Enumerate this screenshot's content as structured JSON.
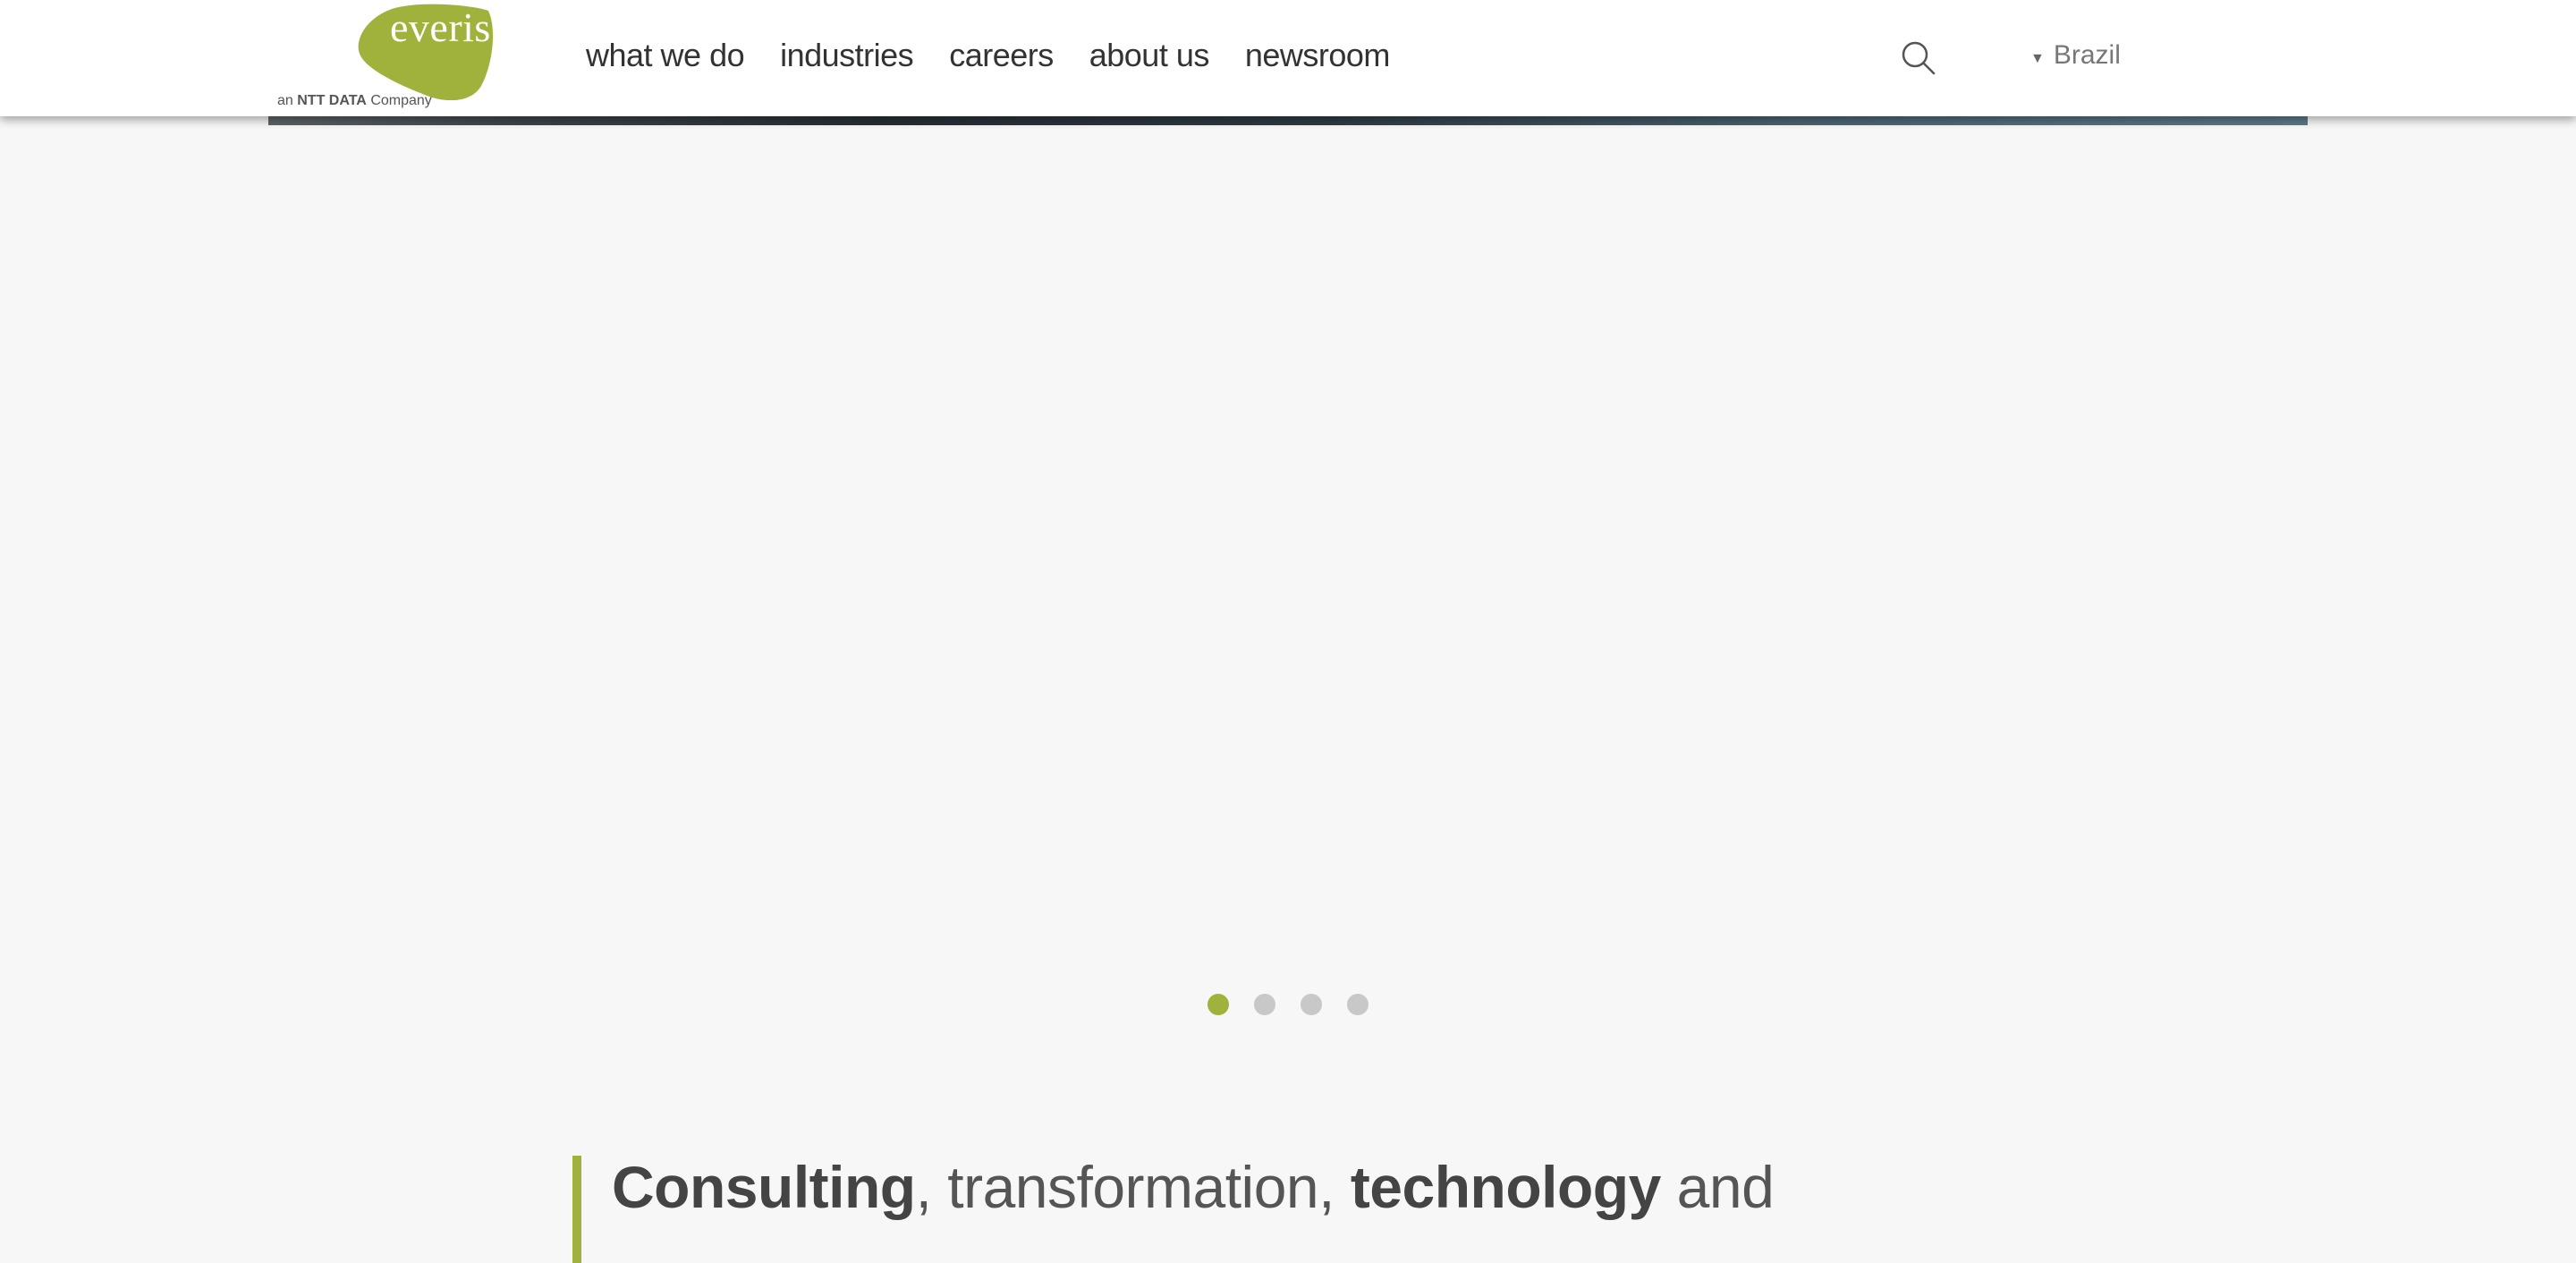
{
  "brand": {
    "logo_text": "everis",
    "tag_prefix": "an",
    "tag_strong": "NTT DATA",
    "tag_suffix": "Company",
    "logo_color": "#a0b23b"
  },
  "nav": {
    "items": [
      {
        "label": "what we do"
      },
      {
        "label": "industries"
      },
      {
        "label": "careers"
      },
      {
        "label": "about us"
      },
      {
        "label": "newsroom"
      }
    ]
  },
  "header_tools": {
    "search_icon": "search-icon",
    "country_arrow": "▼",
    "country_label": "Brazil"
  },
  "carousel": {
    "slides_count": 4,
    "active_index": 0,
    "active_color": "#a0b23b",
    "inactive_color": "#c8c8c8"
  },
  "tagline": {
    "word1": "Consulting",
    "sep1": ", transformation, ",
    "word2": "technology",
    "sep2": " and",
    "accent_color": "#a0b23b"
  }
}
